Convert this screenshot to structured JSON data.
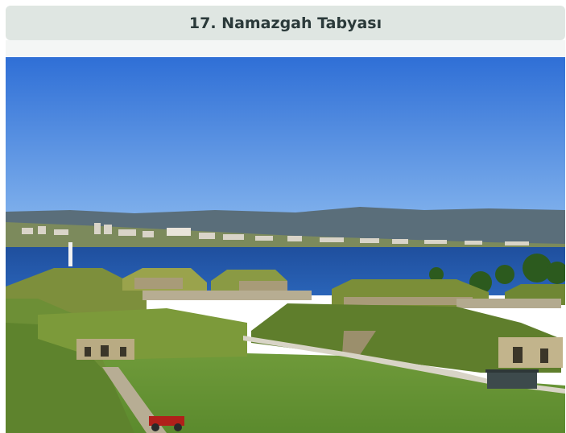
{
  "heading": {
    "title": "17. Namazgah Tabyası"
  },
  "photo": {
    "subject": "coastal fortress with grass-covered bastions overlooking a strait"
  }
}
